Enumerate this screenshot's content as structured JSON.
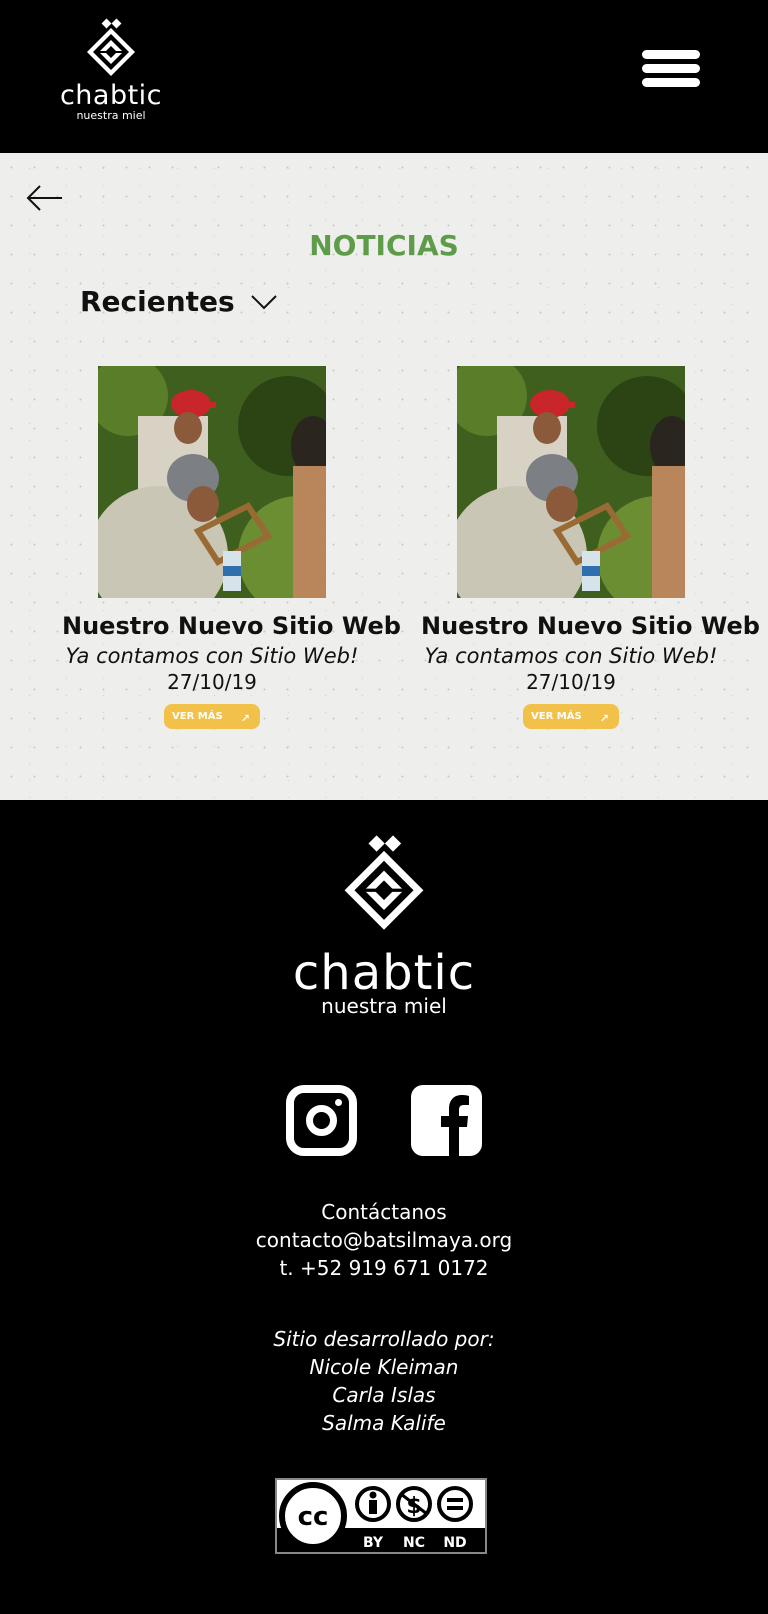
{
  "header": {
    "brand": "chabtic",
    "tagline": "nuestra miel",
    "menu_icon": "hamburger-menu-icon"
  },
  "main": {
    "back_icon": "arrow-left-icon",
    "title": "NOTICIAS",
    "sort": {
      "selected": "Recientes",
      "icon": "chevron-down-icon"
    },
    "articles": [
      {
        "headline": "Nuestro Nuevo Sitio Web",
        "subtitle": "Ya contamos con Sitio Web!",
        "date": "27/10/19",
        "button_label": "VER MÁS"
      },
      {
        "headline": "Nuestro Nuevo Sitio Web",
        "subtitle": "Ya contamos con Sitio Web!",
        "date": "27/10/19",
        "button_label": "VER MÁS"
      }
    ]
  },
  "footer": {
    "brand": "chabtic",
    "tagline": "nuestra miel",
    "social": [
      "instagram-icon",
      "facebook-icon"
    ],
    "contact": {
      "heading": "Contáctanos",
      "email": "contacto@batsilmaya.org",
      "phone": "t. +52 919 671 0172"
    },
    "credits": {
      "heading": "Sitio desarrollado por:",
      "names": [
        "Nicole Kleiman",
        "Carla Islas",
        "Salma Kalife"
      ]
    },
    "license": {
      "cc": "cc",
      "labels": [
        "BY",
        "NC",
        "ND"
      ]
    }
  },
  "colors": {
    "title_green": "#5e9c4a",
    "button_yellow": "#f2c14a",
    "footer_bg": "#000000",
    "content_bg": "#eeeeec"
  }
}
